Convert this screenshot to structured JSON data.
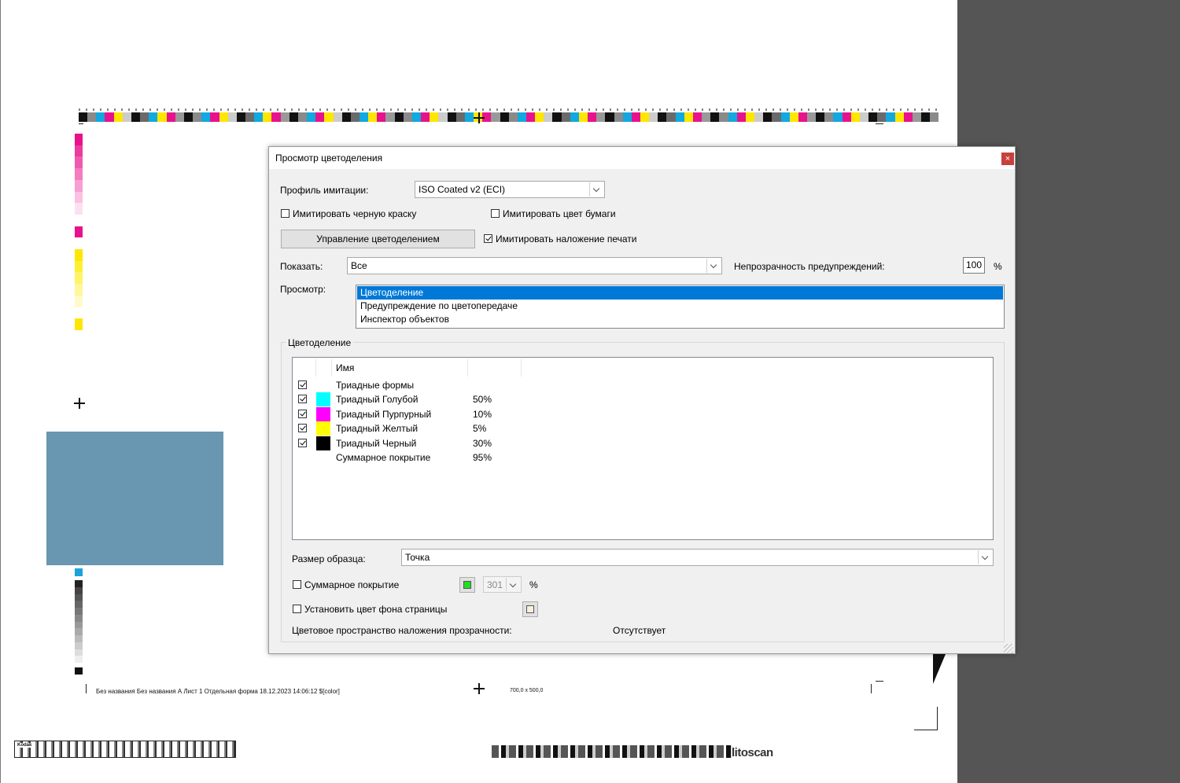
{
  "document": {
    "slug_text": "Без названия Без названия  А Лист 1 Отдельная форма 18.12.2023 14:06:12 $[color]",
    "size_text": "700,0 x 500,0",
    "brand_left": "Kodak",
    "brand_right": "litoscan",
    "top_bar_colors": [
      "#111111",
      "#8a8a8a",
      "#12a8e0",
      "#e8128c",
      "#ffe600",
      "#cccccc",
      "#111111",
      "#6a6a6a",
      "#12a8e0",
      "#ffe600",
      "#e8128c",
      "#999999"
    ],
    "left_bar_colors": [
      "#e8128c",
      "#ec3a9e",
      "#f05aae",
      "#f47cc0",
      "#f89ed2",
      "#fbc0e2",
      "#fde0f0",
      "#ffffff",
      "#e8128c",
      "#ffffff",
      "#ffe600",
      "#fff033",
      "#fff466",
      "#fff799",
      "#fffacc",
      "#ffffff",
      "#ffe600"
    ],
    "left_gray_colors": [
      "#222222",
      "#444444",
      "#555555",
      "#666666",
      "#777777",
      "#888888",
      "#999999",
      "#aaaaaa",
      "#bbbbbb",
      "#cccccc",
      "#dddddd",
      "#eeeeee"
    ]
  },
  "dialog": {
    "title": "Просмотр цветоделения",
    "close_label": "×",
    "profile_label": "Профиль имитации:",
    "profile_value": "ISO Coated v2 (ECI)",
    "simulate_black_label": "Имитировать черную краску",
    "simulate_black_checked": false,
    "simulate_paper_label": "Имитировать цвет бумаги",
    "simulate_paper_checked": false,
    "manage_button_label": "Управление цветоделением",
    "simulate_overprint_label": "Имитировать наложение печати",
    "simulate_overprint_checked": true,
    "show_label": "Показать:",
    "show_value": "Все",
    "warning_opacity_label": "Непрозрачность предупреждений:",
    "warning_opacity_value": "100",
    "percent": "%",
    "preview_label": "Просмотр:",
    "preview_options": [
      "Цветоделение",
      "Предупреждение по цветопередаче",
      "Инспектор объектов"
    ],
    "preview_selected_index": 0,
    "separations_group_title": "Цветоделение",
    "table_header_name": "Имя",
    "rows": [
      {
        "name": "Триадные формы",
        "value": "",
        "checked": true,
        "color": ""
      },
      {
        "name": "Триадный Голубой",
        "value": "50%",
        "checked": true,
        "color": "#00ffff"
      },
      {
        "name": "Триадный Пурпурный",
        "value": "10%",
        "checked": true,
        "color": "#ff00ff"
      },
      {
        "name": "Триадный Желтый",
        "value": "5%",
        "checked": true,
        "color": "#ffff00"
      },
      {
        "name": "Триадный Черный",
        "value": "30%",
        "checked": true,
        "color": "#000000"
      },
      {
        "name": "Суммарное покрытие",
        "value": "95%",
        "checked": null,
        "color": ""
      }
    ],
    "sample_size_label": "Размер образца:",
    "sample_size_value": "Точка",
    "total_coverage_label": "Суммарное покрытие",
    "total_coverage_checked": false,
    "total_coverage_color": "#22dd22",
    "total_coverage_value": "301",
    "page_bg_label": "Установить цвет фона страницы",
    "page_bg_checked": false,
    "page_bg_color": "#f5f0dc",
    "blend_space_label": "Цветовое пространство наложения прозрачности:",
    "blend_space_value": "Отсутствует"
  }
}
